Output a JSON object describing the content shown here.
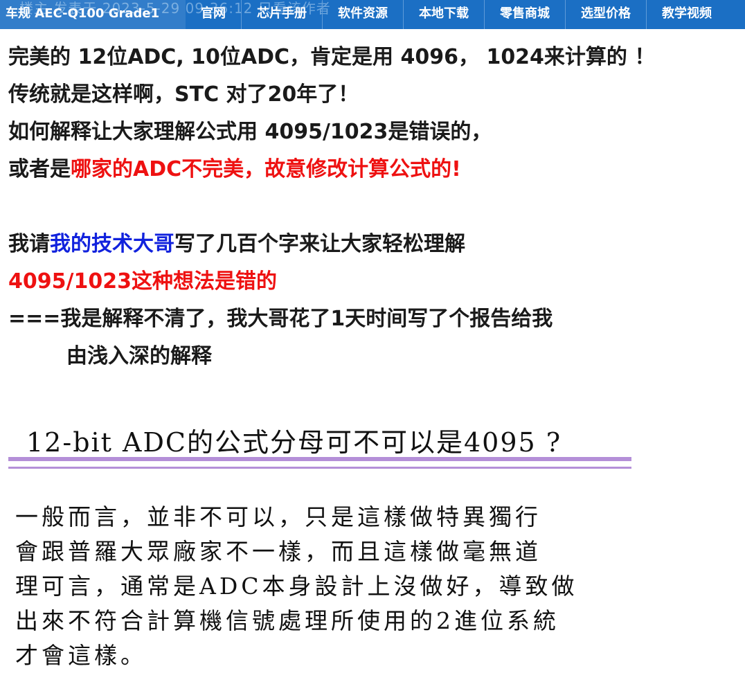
{
  "nav": {
    "faded_text": "楼主  发表于 2023-5-29 09:36:12  只看该作者",
    "brand": "车规 AEC-Q100 Grade1",
    "items": [
      "官网",
      "芯片手册",
      "软件资源",
      "本地下载",
      "零售商城",
      "选型价格",
      "教学视频"
    ]
  },
  "post": {
    "l1": "完美的 12位ADC, 10位ADC，肯定是用 4096， 1024来计算的 ！",
    "l2": "传统就是这样啊，STC 对了20年了！",
    "l3": "如何解释让大家理解公式用 4095/1023是错误的，",
    "l4a": "或者是",
    "l4b": "哪家的ADC不完美，故意修改计算公式的",
    "l4c": "!",
    "l5a": "我请",
    "l5b": "我的技术大哥",
    "l5c": "写了几百个字来让大家轻松理解",
    "l6": "4095/1023这种想法是错的",
    "l7": "===我是解释不清了，我大哥花了1天时间写了个报告给我",
    "l8": "由浅入深的解释"
  },
  "report": {
    "title": "12-bit ADC的公式分母可不可以是4095 ?",
    "lines": [
      "一般而言，並非不可以，只是這樣做特異獨行",
      "會跟普羅大眾廠家不一樣，而且這樣做毫無道",
      "理可言，通常是ADC本身設計上沒做好，導致做",
      "出來不符合計算機信號處理所使用的2進位系統",
      "才會這樣。"
    ]
  },
  "colors": {
    "nav_bg": "#1b6fc4",
    "highlight_red": "#ee1111",
    "highlight_blue": "#1122dd",
    "rule_purple": "#b48fd8"
  }
}
